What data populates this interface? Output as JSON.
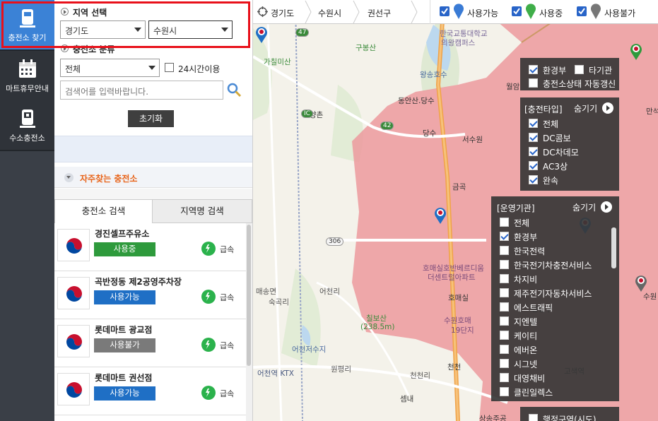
{
  "nav": {
    "station_label": "충전소 찾기",
    "mart_label": "마트휴무안내",
    "hydrogen_label": "수소충전소"
  },
  "region": {
    "title": "지역 선택",
    "province": "경기도",
    "city": "수원시"
  },
  "category": {
    "title": "충전소 분류",
    "value": "전체",
    "open24_label": "24시간이용",
    "search_placeholder": "검색어를 입력바랍니다.",
    "reset_label": "초기화"
  },
  "favorites": {
    "label": "자주찾는 충전소"
  },
  "tabs": {
    "station_search": "충전소 검색",
    "region_search": "지역명 검색"
  },
  "stations": [
    {
      "name": "경진셀프주유소",
      "status": "사용중",
      "status_color": "#2e9a3c",
      "speed": "급속"
    },
    {
      "name": "곡반정동 제2공영주차장",
      "status": "사용가능",
      "status_color": "#1f6fc5",
      "speed": "급속"
    },
    {
      "name": "롯데마트 광교점",
      "status": "사용불가",
      "status_color": "#7a7a7a",
      "speed": "급속"
    },
    {
      "name": "롯데마트 권선점",
      "status": "사용가능",
      "status_color": "#1f6fc5",
      "speed": "급속"
    }
  ],
  "breadcrumb": {
    "level1": "경기도",
    "level2": "수원시",
    "level3": "권선구"
  },
  "legend": {
    "available": "사용가능",
    "in_use": "사용중",
    "unavailable": "사용불가",
    "available_color": "#3a7bd5",
    "in_use_color": "#3fae49",
    "unavailable_color": "#777777"
  },
  "map_panel1": {
    "env_label": "환경부",
    "other_label": "타기관",
    "auto_label": "충전소상태 자동갱신"
  },
  "charge_type": {
    "title": "[충전타입]",
    "hide_label": "숨기기",
    "items": [
      "전체",
      "DC콤보",
      "DC차데모",
      "AC3상",
      "완속"
    ]
  },
  "operator": {
    "title": "[운영기관]",
    "hide_label": "숨기기",
    "items": [
      {
        "label": "전체",
        "checked": false
      },
      {
        "label": "환경부",
        "checked": true
      },
      {
        "label": "한국전력",
        "checked": false
      },
      {
        "label": "한국전기차충전서비스",
        "checked": false
      },
      {
        "label": "차지비",
        "checked": false
      },
      {
        "label": "제주전기자동차서비스",
        "checked": false
      },
      {
        "label": "에스트래픽",
        "checked": false
      },
      {
        "label": "지엔텔",
        "checked": false
      },
      {
        "label": "케이티",
        "checked": false
      },
      {
        "label": "에버온",
        "checked": false
      },
      {
        "label": "시그넷",
        "checked": false
      },
      {
        "label": "대영채비",
        "checked": false
      },
      {
        "label": "클린일렉스",
        "checked": false
      }
    ]
  },
  "admin_area": {
    "label": "행정구역(시도)"
  },
  "map_labels": {
    "lbl1": "한국교통대학교",
    "lbl2": "의왕캠퍼스",
    "lbl3": "구봉산",
    "lbl4": "가칠미산",
    "lbl5": "왕송호수",
    "lbl6": "동안산.당수",
    "lbl7": "양촌",
    "lbl8": "당수",
    "lbl9": "서수원",
    "lbl10": "금곡",
    "lbl11": "호매실호반베르디움",
    "lbl12": "더센트럴아파트",
    "lbl13": "호매실",
    "lbl14": "칠보산",
    "lbl15": "(238.5m)",
    "lbl16": "매송면",
    "lbl17": "숙곡리",
    "lbl18": "어천리",
    "lbl19": "어천저수지",
    "lbl20": "어천역 KTX",
    "lbl21": "원평리",
    "lbl22": "천천리",
    "lbl23": "천천",
    "lbl24": "권선구",
    "lbl25": "수원호매",
    "lbl26": "19단지",
    "lbl27": "셈내",
    "lbl28": "월암",
    "lbl29": "만석",
    "lbl30": "수원",
    "lbl31": "고색역",
    "lbl32": "상송주공",
    "lbl33": "IC",
    "road1": "42",
    "road2": "47",
    "road3": "306"
  }
}
